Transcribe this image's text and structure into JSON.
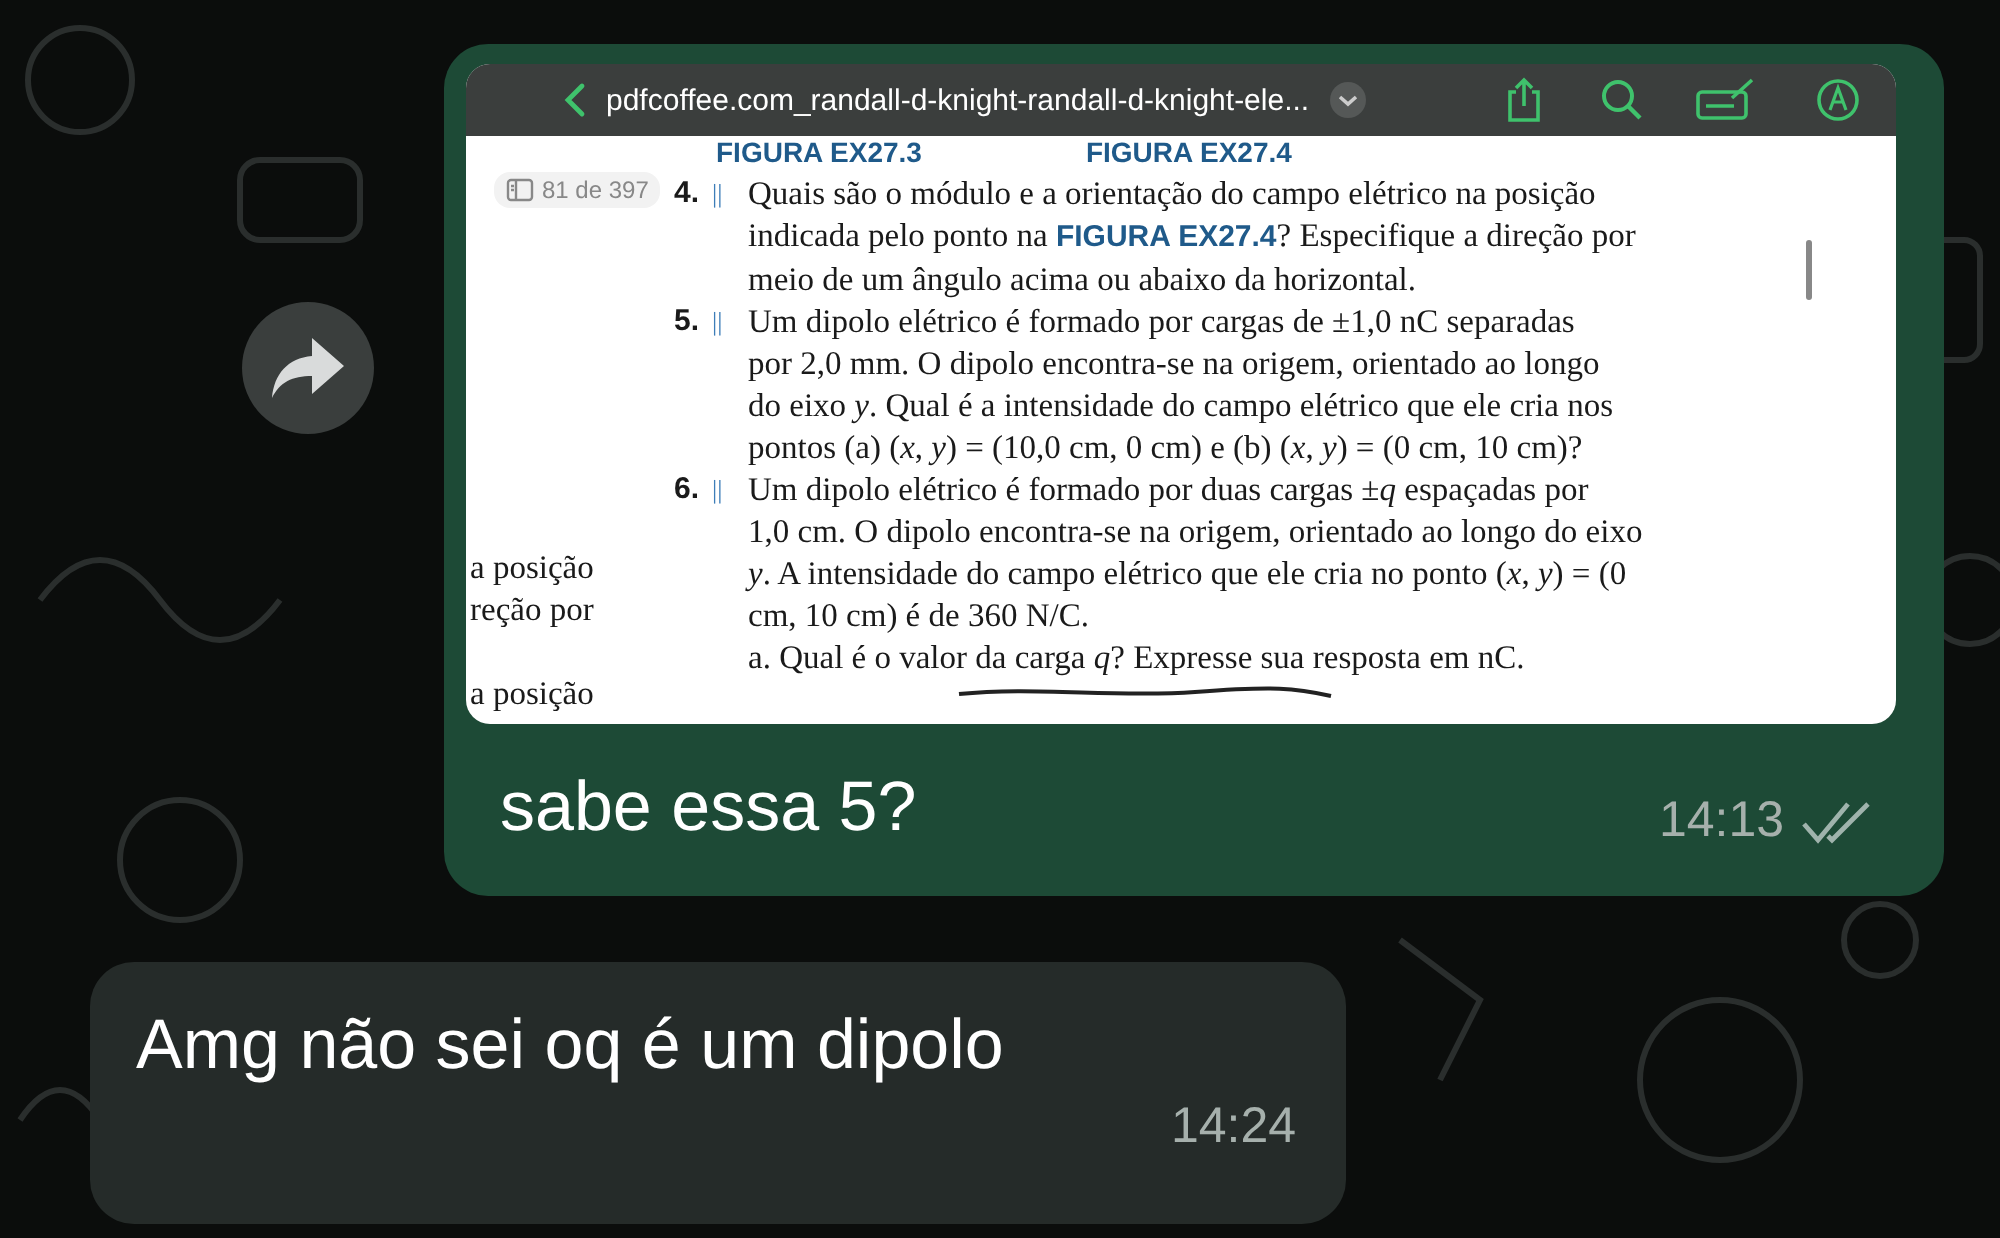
{
  "shared_image": {
    "toolbar": {
      "title": "pdfcoffee.com_randall-d-knight-randall-d-knight-ele..."
    },
    "page_indicator": "81 de 397",
    "figure_captions": [
      "FIGURA EX27.3",
      "FIGURA EX27.4"
    ],
    "side_fragments": [
      "a posição",
      "reção por",
      "a posição"
    ],
    "problems": [
      {
        "number": "4.",
        "mark": "||",
        "lines": [
          "Quais são o módulo e a orientação do campo elétrico na posição",
          "indicada pelo ponto na **FIGURA EX27.4**? Especifique a direção por",
          "meio de um ângulo acima ou abaixo da horizontal."
        ]
      },
      {
        "number": "5.",
        "mark": "||",
        "lines": [
          "Um dipolo elétrico é formado por cargas de ±1,0 nC separadas",
          "por 2,0 mm. O dipolo encontra-se na origem, orientado ao longo",
          "do eixo *y*. Qual é a intensidade do campo elétrico que ele cria nos",
          "pontos (a) (*x*, *y*) = (10,0 cm, 0 cm) e (b) (*x*, *y*) = (0 cm, 10 cm)?"
        ]
      },
      {
        "number": "6.",
        "mark": "||",
        "lines": [
          "Um dipolo elétrico é formado por duas cargas ±*q* espaçadas por",
          "1,0 cm. O dipolo encontra-se na origem, orientado ao longo do eixo",
          "*y*. A intensidade do campo elétrico que ele cria no ponto (*x*, *y*) = (0",
          "cm, 10 cm) é de 360 N/C.",
          "a. Qual é o valor da carga *q*? Expresse sua resposta em nC."
        ]
      }
    ]
  },
  "messages": [
    {
      "kind": "outgoing",
      "text": "sabe essa 5?",
      "time": "14:13",
      "read": true
    },
    {
      "kind": "incoming",
      "text": "Amg não sei oq é um dipolo",
      "time": "14:24"
    }
  ]
}
